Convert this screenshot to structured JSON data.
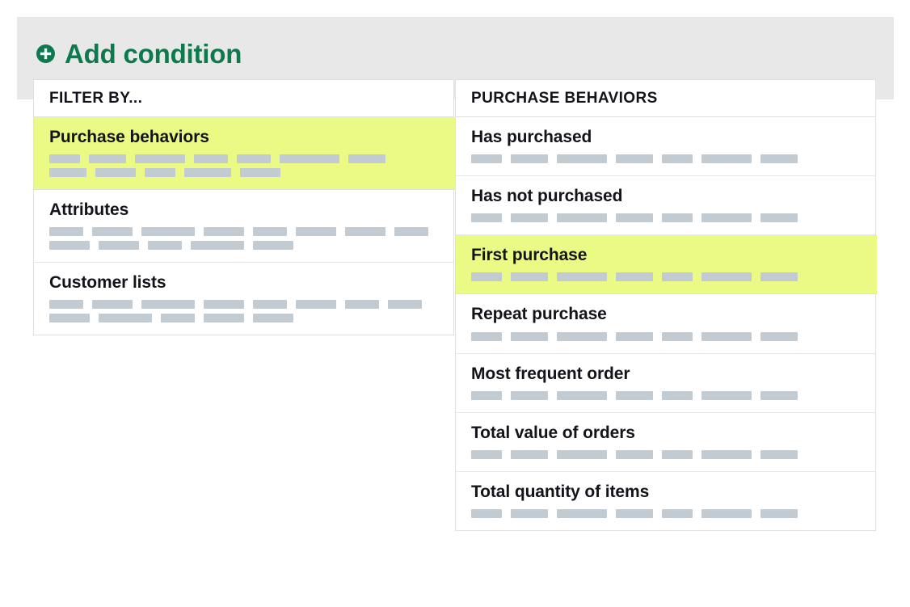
{
  "header": {
    "title": "Add condition",
    "icon": "plus-circle-icon",
    "accent_color": "#0c7a4d",
    "backdrop_color": "#e8e8e8"
  },
  "theme": {
    "highlight_color": "#eafa84",
    "skeleton_bar_color": "#c3cbd2",
    "panel_border_color": "#dde1e6",
    "text_color": "#12141a"
  },
  "left_panel": {
    "header": "FILTER BY...",
    "items": [
      {
        "label": "Purchase behaviors",
        "selected": true,
        "skeleton": [
          [
            38,
            46,
            62,
            42,
            42,
            74,
            46
          ],
          [
            46,
            50,
            38,
            58,
            50
          ]
        ]
      },
      {
        "label": "Attributes",
        "selected": false,
        "skeleton": [
          [
            42,
            50,
            66,
            50,
            42,
            50,
            50,
            42
          ],
          [
            50,
            50,
            42,
            66,
            50
          ]
        ]
      },
      {
        "label": "Customer lists",
        "selected": false,
        "skeleton": [
          [
            42,
            50,
            66,
            50,
            42,
            50,
            42,
            42
          ],
          [
            50,
            66,
            42,
            50,
            50
          ]
        ]
      }
    ]
  },
  "right_panel": {
    "header": "PURCHASE BEHAVIORS",
    "items": [
      {
        "label": "Has purchased",
        "selected": false,
        "skeleton": [
          [
            38,
            46,
            62,
            46,
            38,
            62,
            46
          ]
        ]
      },
      {
        "label": "Has not purchased",
        "selected": false,
        "skeleton": [
          [
            38,
            46,
            62,
            46,
            38,
            62,
            46
          ]
        ]
      },
      {
        "label": "First purchase",
        "selected": true,
        "skeleton": [
          [
            38,
            46,
            62,
            46,
            38,
            62,
            46
          ]
        ]
      },
      {
        "label": "Repeat purchase",
        "selected": false,
        "skeleton": [
          [
            38,
            46,
            62,
            46,
            38,
            62,
            46
          ]
        ]
      },
      {
        "label": "Most frequent order",
        "selected": false,
        "skeleton": [
          [
            38,
            46,
            62,
            46,
            38,
            62,
            46
          ]
        ]
      },
      {
        "label": "Total value of orders",
        "selected": false,
        "skeleton": [
          [
            38,
            46,
            62,
            46,
            38,
            62,
            46
          ]
        ]
      },
      {
        "label": "Total quantity of items",
        "selected": false,
        "skeleton": [
          [
            38,
            46,
            62,
            46,
            38,
            62,
            46
          ]
        ]
      }
    ]
  }
}
